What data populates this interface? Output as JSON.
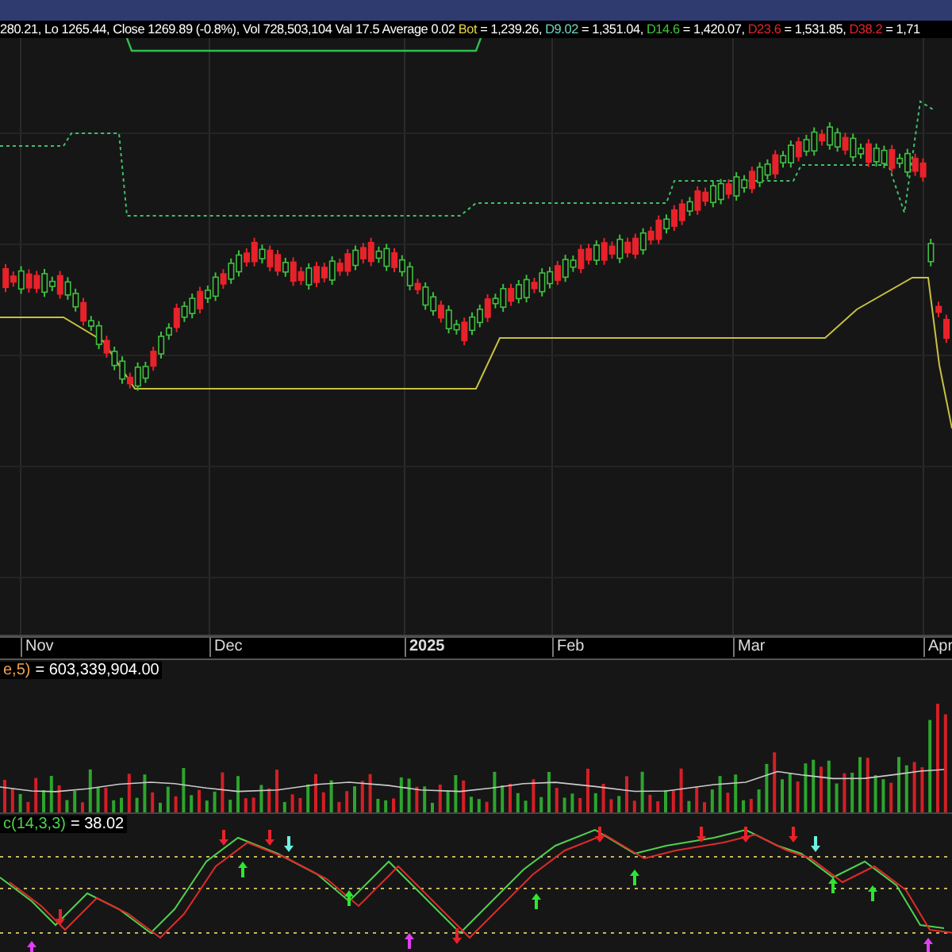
{
  "header": {
    "quote": "280.21, Lo 1265.44, Close 1269.89 (-0.8%), Vol 728,503,104 Val 17.5 Average 0.02",
    "levels": [
      {
        "label": "Bot",
        "value": "= 1,239.26,",
        "color": "#e8d44a"
      },
      {
        "label": "D9.02",
        "value": "= 1,351.04,",
        "color": "#6fd6c4"
      },
      {
        "label": "D14.6",
        "value": "= 1,420.07,",
        "color": "#3fc43f"
      },
      {
        "label": "D23.6",
        "value": "= 1,531.85,",
        "color": "#e0262b"
      },
      {
        "label": "D38.2",
        "value": "= 1,71",
        "color": "#e0262b"
      }
    ]
  },
  "x_axis": [
    {
      "label": "Nov",
      "kind": "month"
    },
    {
      "label": "Dec",
      "kind": "month"
    },
    {
      "label": "2025",
      "kind": "year"
    },
    {
      "label": "Feb",
      "kind": "month"
    },
    {
      "label": "Mar",
      "kind": "month"
    },
    {
      "label": "Apr",
      "kind": "month"
    }
  ],
  "volume": {
    "name": "e,5)",
    "value": "= 603,339,904.00"
  },
  "stochastic": {
    "name": "c(14,3,3)",
    "value": "= 38.02"
  }
}
